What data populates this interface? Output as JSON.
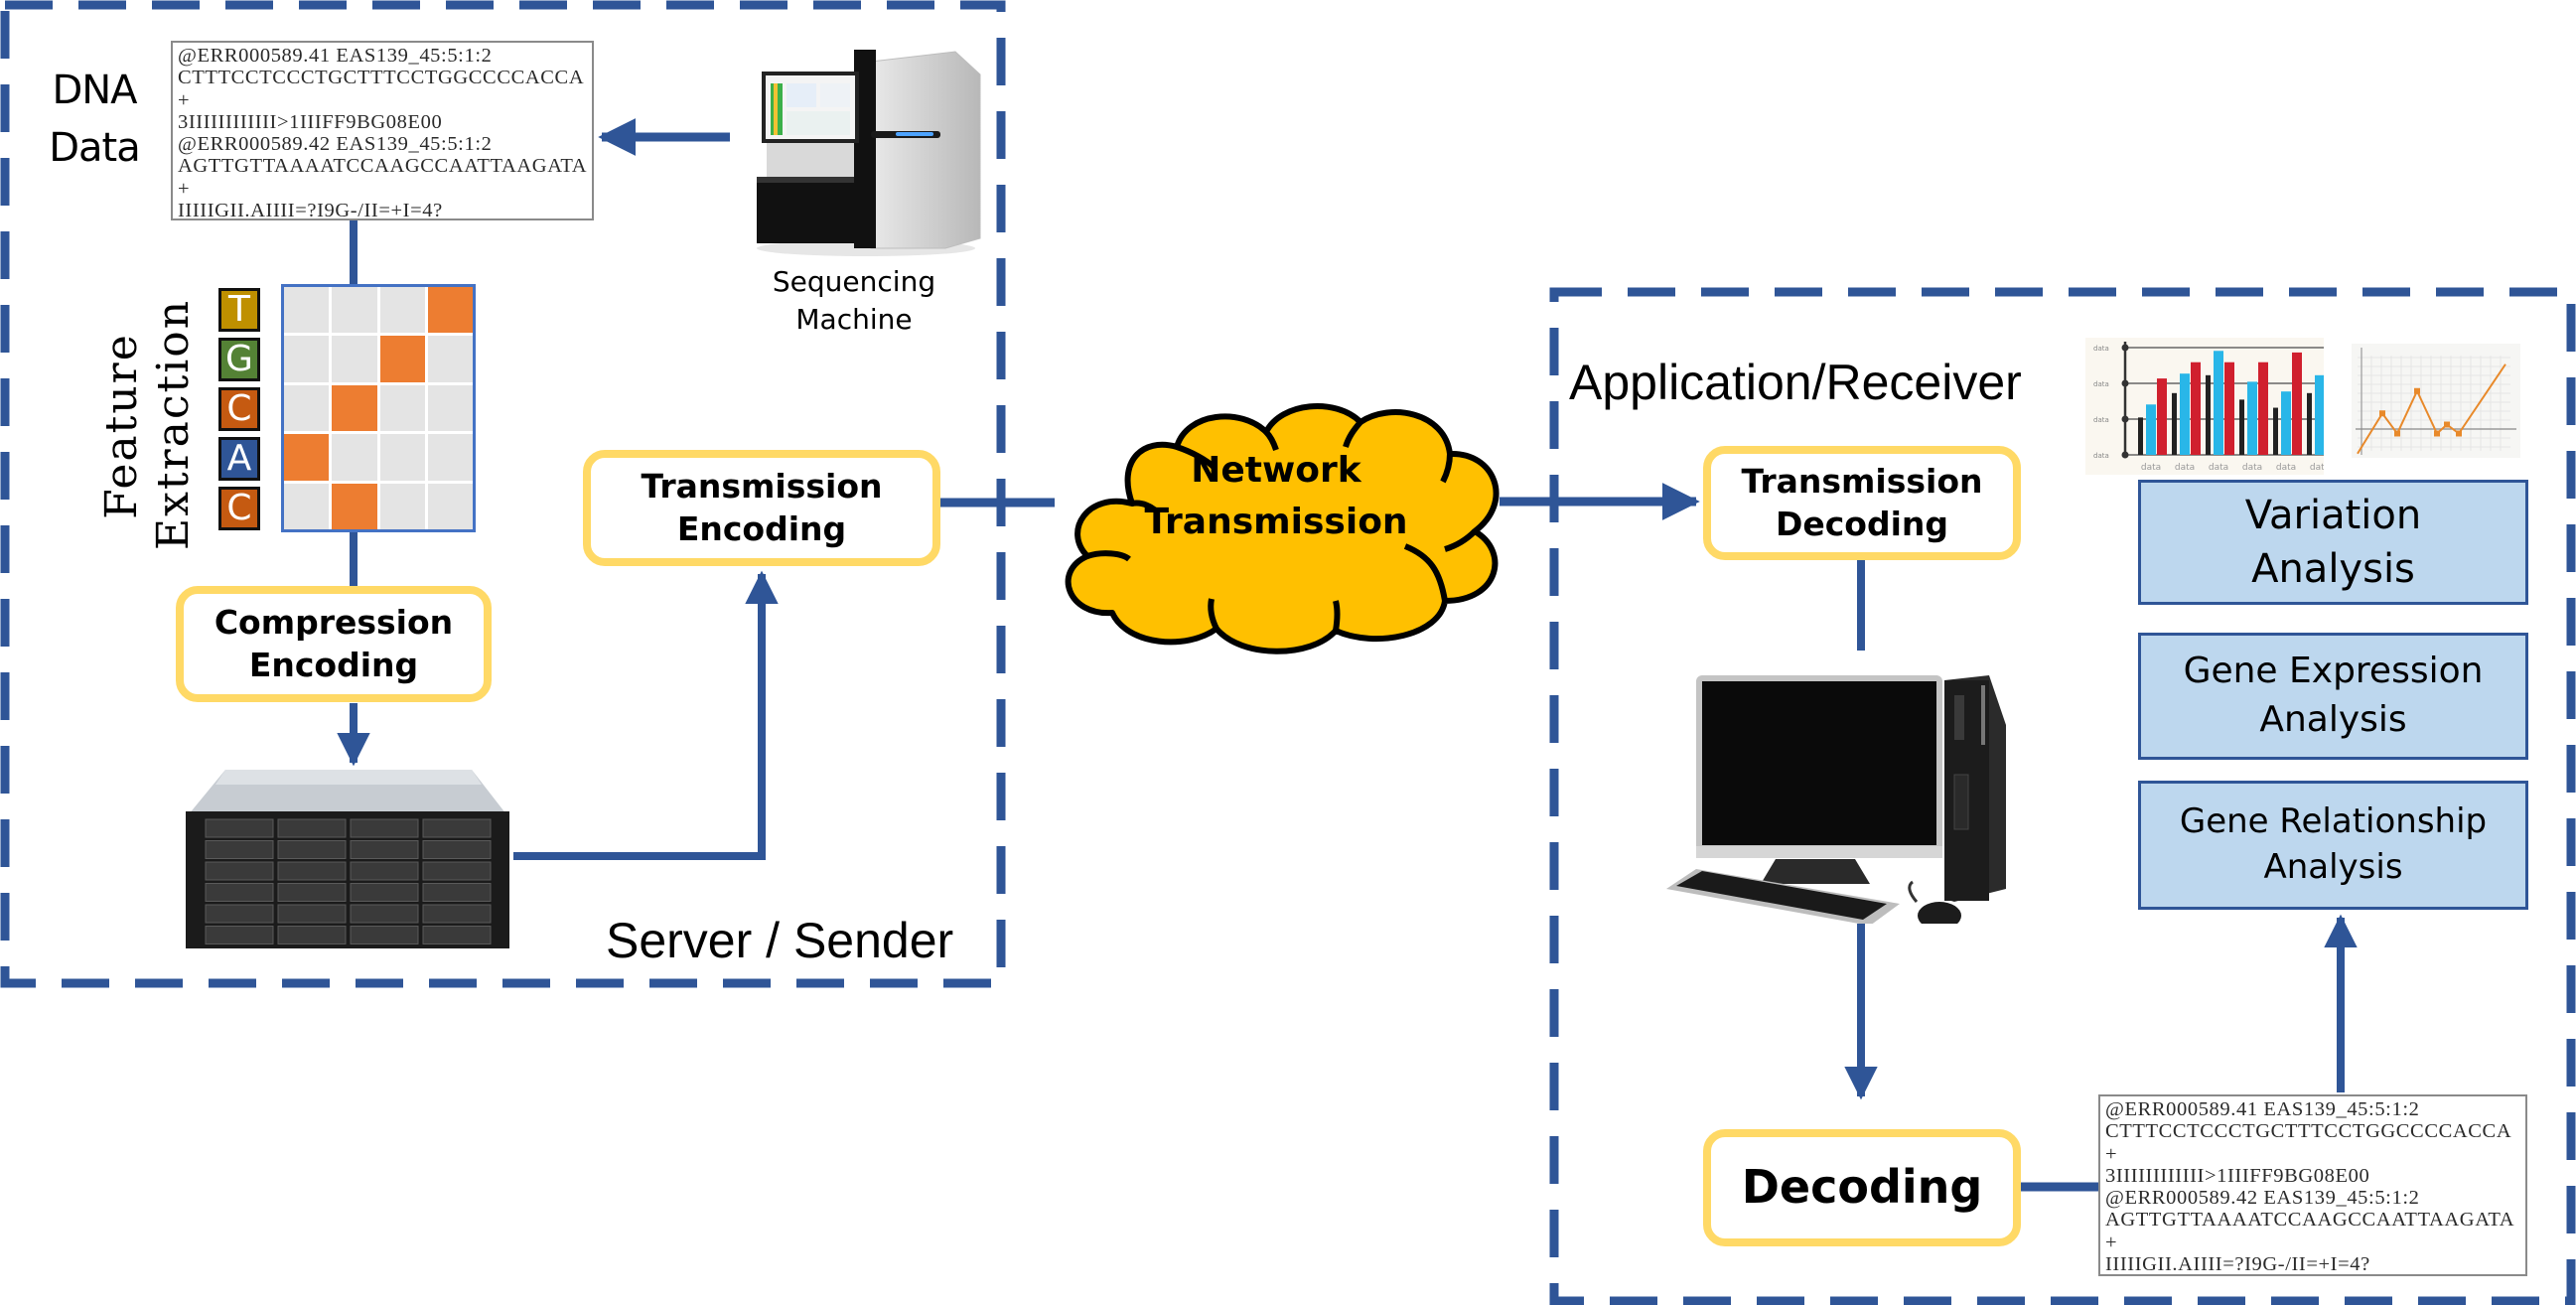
{
  "figure": {
    "sender_panel": {
      "label": "Server / Sender",
      "dna_data": {
        "label_line1": "DNA",
        "label_line2": "Data",
        "fastq_lines": [
          "@ERR000589.41 EAS139_45:5:1:2",
          "CTTTCCTCCCTGCTTTCCTGGCCCCACCA",
          "+",
          "3IIIIIIIIIIII>1IIIFF9BG08E00",
          "@ERR000589.42 EAS139_45:5:1:2",
          "AGTTGTTAAAATCCAAGCCAATTAAGATA",
          "+",
          "IIIIIGII.AIIII=?I9G-/II=+I=4?"
        ]
      },
      "sequencing_machine": {
        "caption_line1": "Sequencing",
        "caption_line2": "Machine",
        "icon": "sequencer-icon"
      },
      "feature_extraction": {
        "label_line1": "Feature",
        "label_line2": "Extraction",
        "bases": [
          {
            "letter": "T",
            "color": "#bf9000",
            "hot_column": 4
          },
          {
            "letter": "G",
            "color": "#548235",
            "hot_column": 3
          },
          {
            "letter": "C",
            "color": "#c55a11",
            "hot_column": 2
          },
          {
            "letter": "A",
            "color": "#2f5597",
            "hot_column": 1
          },
          {
            "letter": "C",
            "color": "#c55a11",
            "hot_column": 2
          }
        ],
        "columns": 4
      },
      "compression_encoding": {
        "line1": "Compression",
        "line2": "Encoding"
      },
      "server": {
        "icon": "server-rack-icon"
      },
      "transmission_encoding": {
        "line1": "Transmission",
        "line2": "Encoding"
      }
    },
    "network": {
      "line1": "Network",
      "line2": "Transmission"
    },
    "receiver_panel": {
      "label": "Application/Receiver",
      "transmission_decoding": {
        "line1": "Transmission",
        "line2": "Decoding"
      },
      "computer": {
        "icon": "desktop-computer-icon"
      },
      "decoding": {
        "label": "Decoding"
      },
      "decoded_fastq_lines": [
        "@ERR000589.41 EAS139_45:5:1:2",
        "CTTTCCTCCCTGCTTTCCTGGCCCCACCA",
        "+",
        "3IIIIIIIIIIII>1IIIFF9BG08E00",
        "@ERR000589.42 EAS139_45:5:1:2",
        "AGTTGTTAAAATCCAAGCCAATTAAGATA",
        "+",
        "IIIIIGII.AIIII=?I9G-/II=+I=4?"
      ],
      "analyses": [
        {
          "line1": "Variation",
          "line2": "Analysis"
        },
        {
          "line1": "Gene Expression",
          "line2": "Analysis"
        },
        {
          "line1": "Gene Relationship",
          "line2": "Analysis"
        }
      ],
      "illustrations": {
        "bar_chart": {
          "icon": "bar-chart-icon",
          "tick_label": "data",
          "category_labels": [
            "data",
            "data",
            "data",
            "data",
            "data",
            "data"
          ],
          "series": [
            {
              "name": "dark",
              "color": "#222222",
              "values": [
                1.15,
                1.9,
                2.45,
                1.7,
                1.45,
                1.9
              ]
            },
            {
              "name": "cyan",
              "color": "#29b6e8",
              "values": [
                1.55,
                2.5,
                3.2,
                2.25,
                1.95,
                2.45
              ]
            },
            {
              "name": "red",
              "color": "#d0202e",
              "values": [
                2.35,
                2.85,
                2.85,
                2.85,
                3.15,
                2.9
              ]
            }
          ]
        },
        "line_chart": {
          "icon": "line-chart-icon",
          "color": "#e8892a",
          "points": [
            -0.55,
            0.35,
            -0.1,
            0.85,
            -0.1,
            0.1,
            -0.1,
            1.45
          ]
        }
      }
    },
    "colors": {
      "connector": "#2f5597",
      "yellow_border": "#ffd966",
      "cloud_fill": "#ffc000",
      "analysis_fill": "#bdd7ee",
      "grid_hot": "#ed7d31",
      "grid_cold": "#e4e4e4"
    }
  }
}
